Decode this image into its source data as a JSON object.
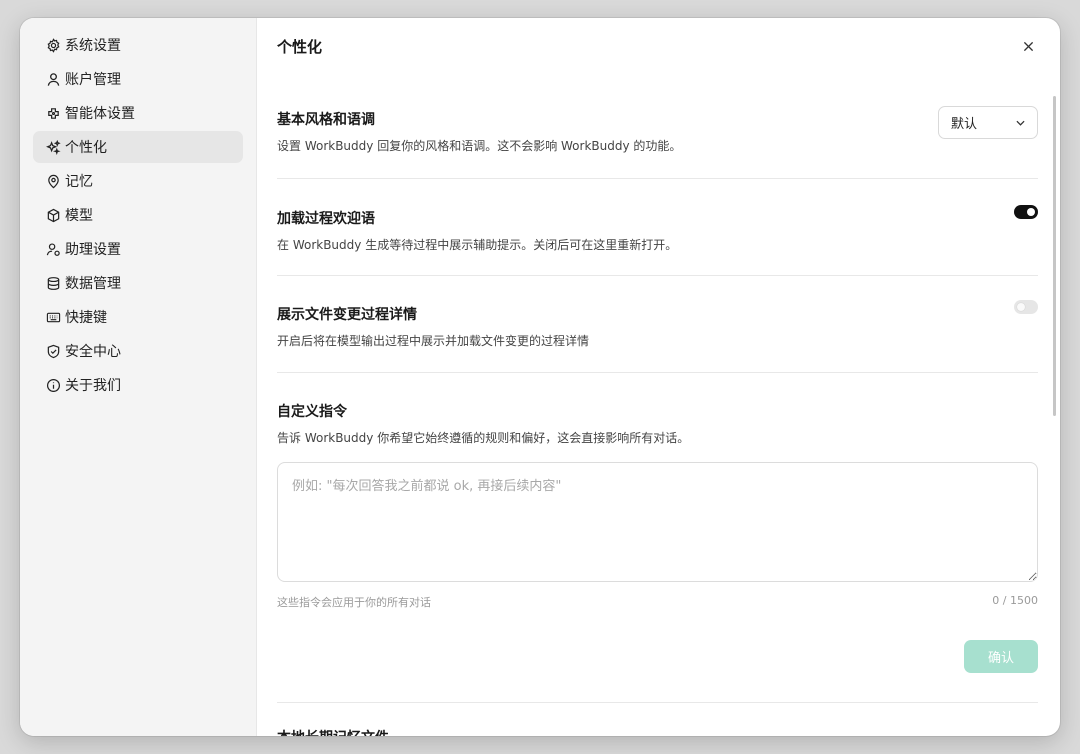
{
  "sidebar": {
    "items": [
      {
        "label": "系统设置",
        "icon": "gear-icon"
      },
      {
        "label": "账户管理",
        "icon": "user-icon"
      },
      {
        "label": "智能体设置",
        "icon": "agent-icon"
      },
      {
        "label": "个性化",
        "icon": "sparkle-icon",
        "active": true
      },
      {
        "label": "记忆",
        "icon": "memory-icon"
      },
      {
        "label": "模型",
        "icon": "cube-icon"
      },
      {
        "label": "助理设置",
        "icon": "assistant-icon"
      },
      {
        "label": "数据管理",
        "icon": "database-icon"
      },
      {
        "label": "快捷键",
        "icon": "keyboard-icon"
      },
      {
        "label": "安全中心",
        "icon": "shield-icon"
      },
      {
        "label": "关于我们",
        "icon": "info-icon"
      }
    ]
  },
  "header": {
    "title": "个性化",
    "close_icon": "close-icon"
  },
  "sections": {
    "style": {
      "title": "基本风格和语调",
      "desc": "设置 WorkBuddy 回复你的风格和语调。这不会影响 WorkBuddy 的功能。",
      "select_value": "默认"
    },
    "loading": {
      "title": "加载过程欢迎语",
      "desc": "在 WorkBuddy 生成等待过程中展示辅助提示。关闭后可在这里重新打开。",
      "enabled": true
    },
    "filechange": {
      "title": "展示文件变更过程详情",
      "desc": "开启后将在模型输出过程中展示并加载文件变更的过程详情",
      "enabled": false
    },
    "custom": {
      "title": "自定义指令",
      "desc": "告诉 WorkBuddy 你希望它始终遵循的规则和偏好，这会直接影响所有对话。",
      "placeholder": "例如: \"每次回答我之前都说 ok, 再接后续内容\"",
      "value": "",
      "hint": "这些指令会应用于你的所有对话",
      "counter": "0 / 1500",
      "confirm_label": "确认"
    },
    "next": {
      "title": "本地长期记忆文件"
    }
  },
  "colors": {
    "accent_disabled": "#a7e0cf",
    "toggle_on": "#111111",
    "toggle_off": "#e6e6e6",
    "active_nav": "#e6e6e6"
  }
}
